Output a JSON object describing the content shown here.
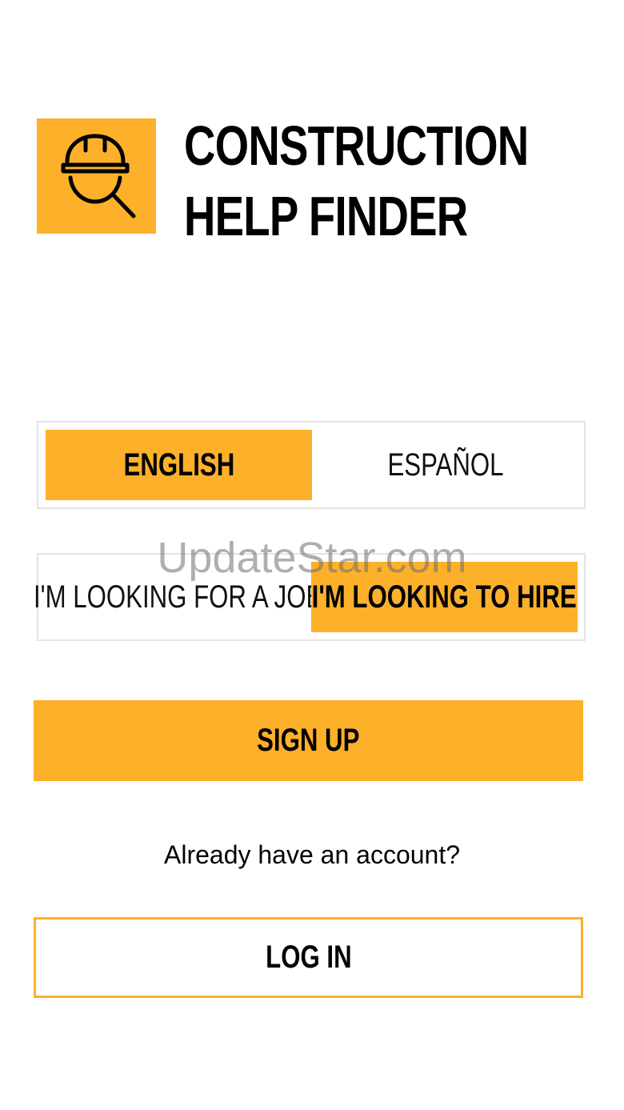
{
  "brand": {
    "title_line1": "CONSTRUCTION",
    "title_line2": "HELP FINDER",
    "logo_icon": "hardhat-search-icon",
    "accent_color": "#FDB02A"
  },
  "language_toggle": {
    "options": [
      {
        "label": "ENGLISH",
        "selected": true
      },
      {
        "label": "ESPAÑOL",
        "selected": false
      }
    ]
  },
  "role_toggle": {
    "options": [
      {
        "label": "I'M LOOKING FOR A JOB",
        "selected": false
      },
      {
        "label": "I'M LOOKING TO HIRE",
        "selected": true
      }
    ]
  },
  "actions": {
    "signup_label": "SIGN UP",
    "account_prompt": "Already have an account?",
    "login_label": "LOG IN"
  },
  "watermark": "UpdateStar.com"
}
